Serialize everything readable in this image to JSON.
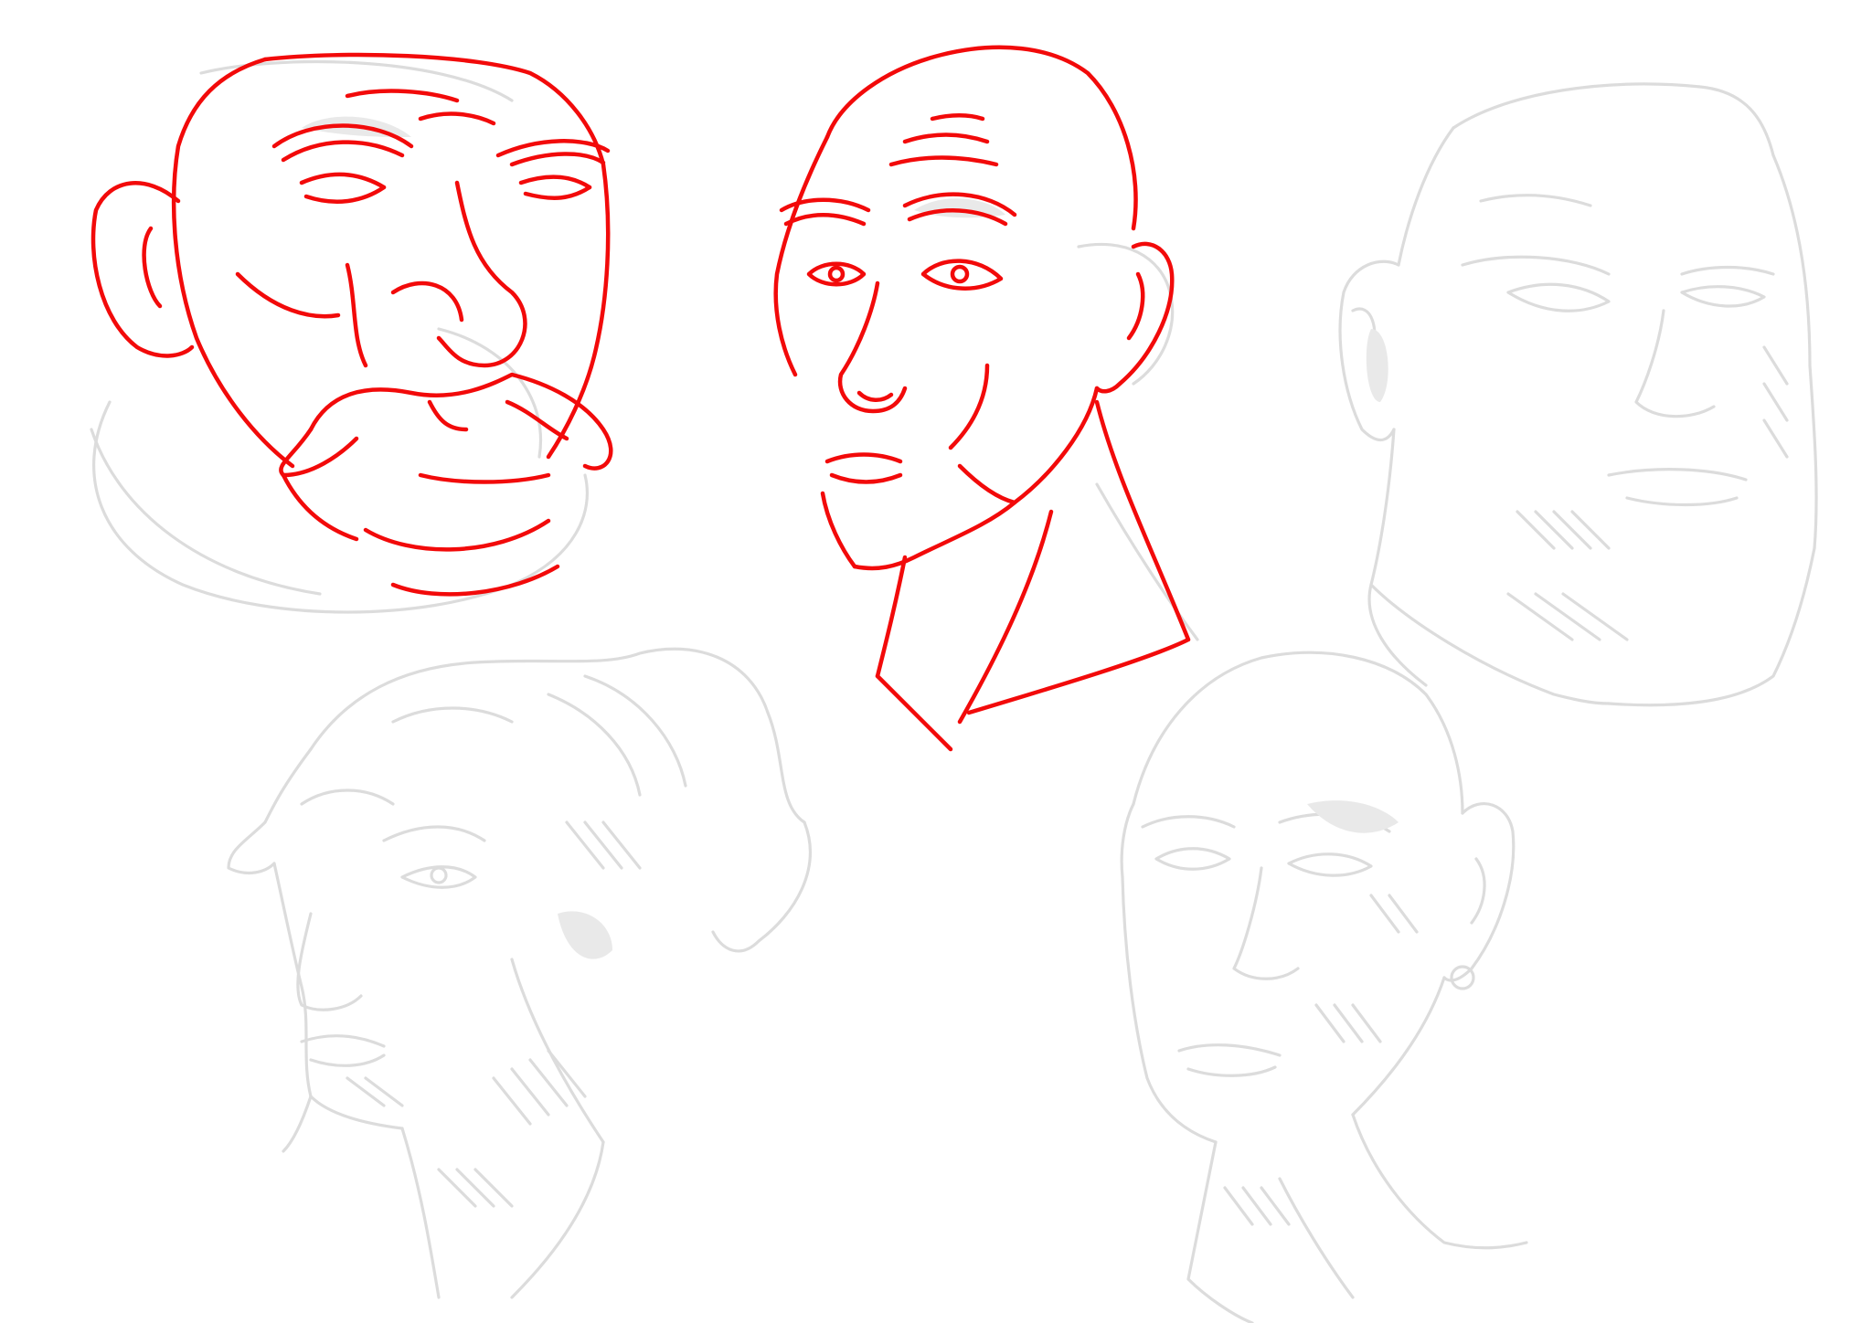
{
  "colors": {
    "background": "#ffffff",
    "ink": "#f20a0a",
    "sketch_gray": "#dcdcdc",
    "shadow_gray": "#e9e9e9"
  },
  "sketches": [
    {
      "name": "mustached-bald-man",
      "style": "red-inked"
    },
    {
      "name": "bald-man-three-quarter",
      "style": "red-inked"
    },
    {
      "name": "square-jaw-man",
      "style": "gray-pencil"
    },
    {
      "name": "curly-haired-woman",
      "style": "gray-pencil"
    },
    {
      "name": "bald-man-earring",
      "style": "gray-pencil"
    }
  ]
}
